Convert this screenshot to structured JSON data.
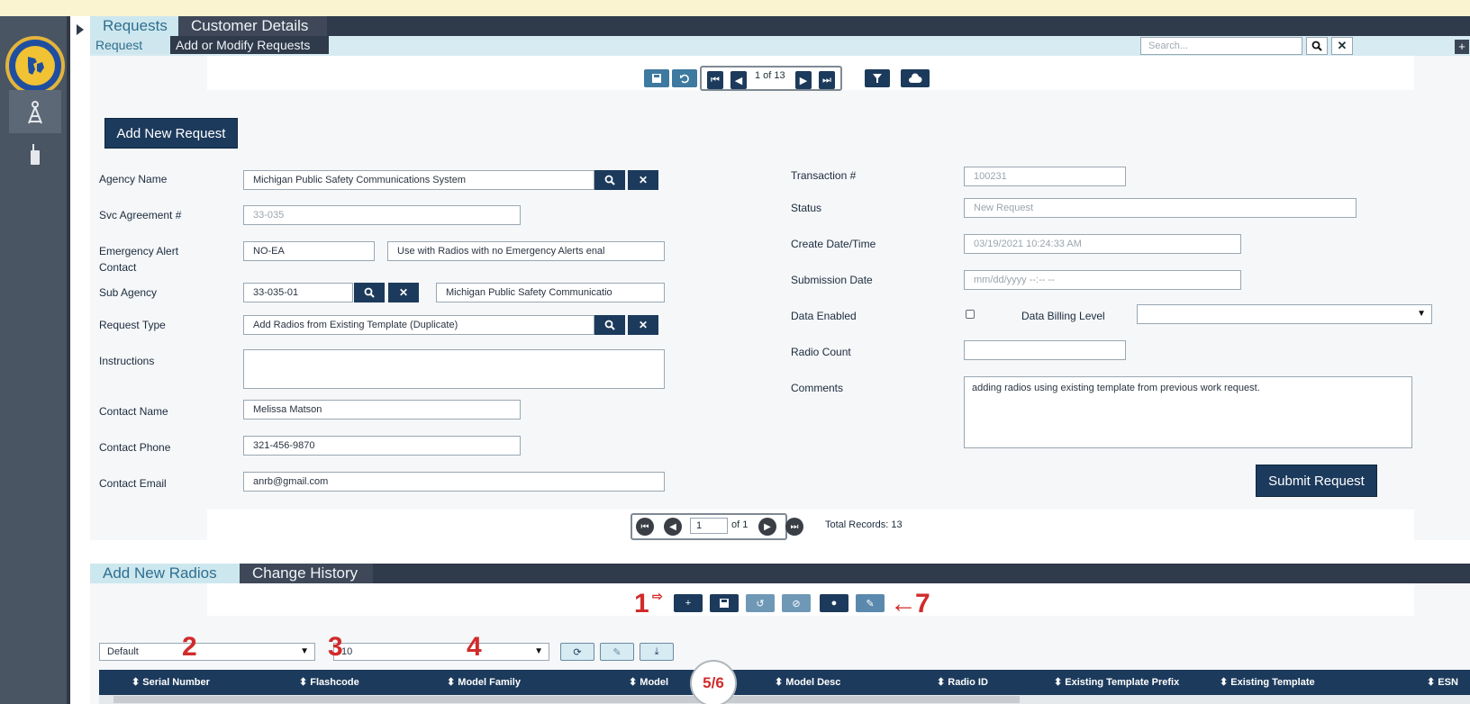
{
  "nav": {
    "outer_tabs": [
      "Requests",
      "Customer Details"
    ],
    "inner_tabs": [
      "Request List",
      "Add or Modify Requests"
    ],
    "search_placeholder": "Search..."
  },
  "toolbar": {
    "pager_text": "1 of 13"
  },
  "form": {
    "add_new_request": "Add New Request",
    "labels": {
      "agency_name": "Agency Name",
      "svc_agreement": "Svc Agreement #",
      "emergency_alert_1": "Emergency Alert",
      "emergency_alert_2": "Contact",
      "sub_agency": "Sub Agency",
      "request_type": "Request Type",
      "instructions": "Instructions",
      "contact_name": "Contact Name",
      "contact_phone": "Contact Phone",
      "contact_email": "Contact Email",
      "transaction": "Transaction #",
      "status": "Status",
      "create_datetime": "Create Date/Time",
      "submission_date": "Submission Date",
      "data_enabled": "Data Enabled",
      "data_billing_level": "Data Billing Level",
      "radio_count": "Radio Count",
      "comments": "Comments"
    },
    "values": {
      "agency_name": "Michigan Public Safety Communications System",
      "svc_agreement": "33-035",
      "emergency_alert_code": "NO-EA",
      "emergency_alert_desc": "Use with Radios with no Emergency Alerts enal",
      "sub_agency_code": "33-035-01",
      "sub_agency_name": "Michigan Public Safety Communicatio",
      "request_type": "Add Radios from Existing Template (Duplicate)",
      "instructions": "",
      "contact_name": "Melissa  Matson",
      "contact_phone": "321-456-9870",
      "contact_email": "anrb@gmail.com",
      "transaction": "100231",
      "status": "New Request",
      "create_datetime": "03/19/2021 10:24:33 AM",
      "submission_date_placeholder": "mm/dd/yyyy --:-- --",
      "data_billing_level": "",
      "radio_count": "",
      "comments": "adding radios using existing template from previous work request."
    },
    "submit": "Submit Request"
  },
  "pager_bottom": {
    "page": "1",
    "of": "of 1",
    "total": "Total Records: 13"
  },
  "radios": {
    "tabs": [
      "Add New Radios",
      "Change History"
    ],
    "annotations": [
      "1",
      "2",
      "3",
      "4",
      "5/6",
      "7"
    ],
    "view_select": "Default",
    "page_size_select": "10",
    "columns": [
      "Serial Number",
      "Flashcode",
      "Model Family",
      "Model",
      "Model Desc",
      "Radio ID",
      "Existing Template Prefix",
      "Existing Template",
      "ESN"
    ]
  }
}
